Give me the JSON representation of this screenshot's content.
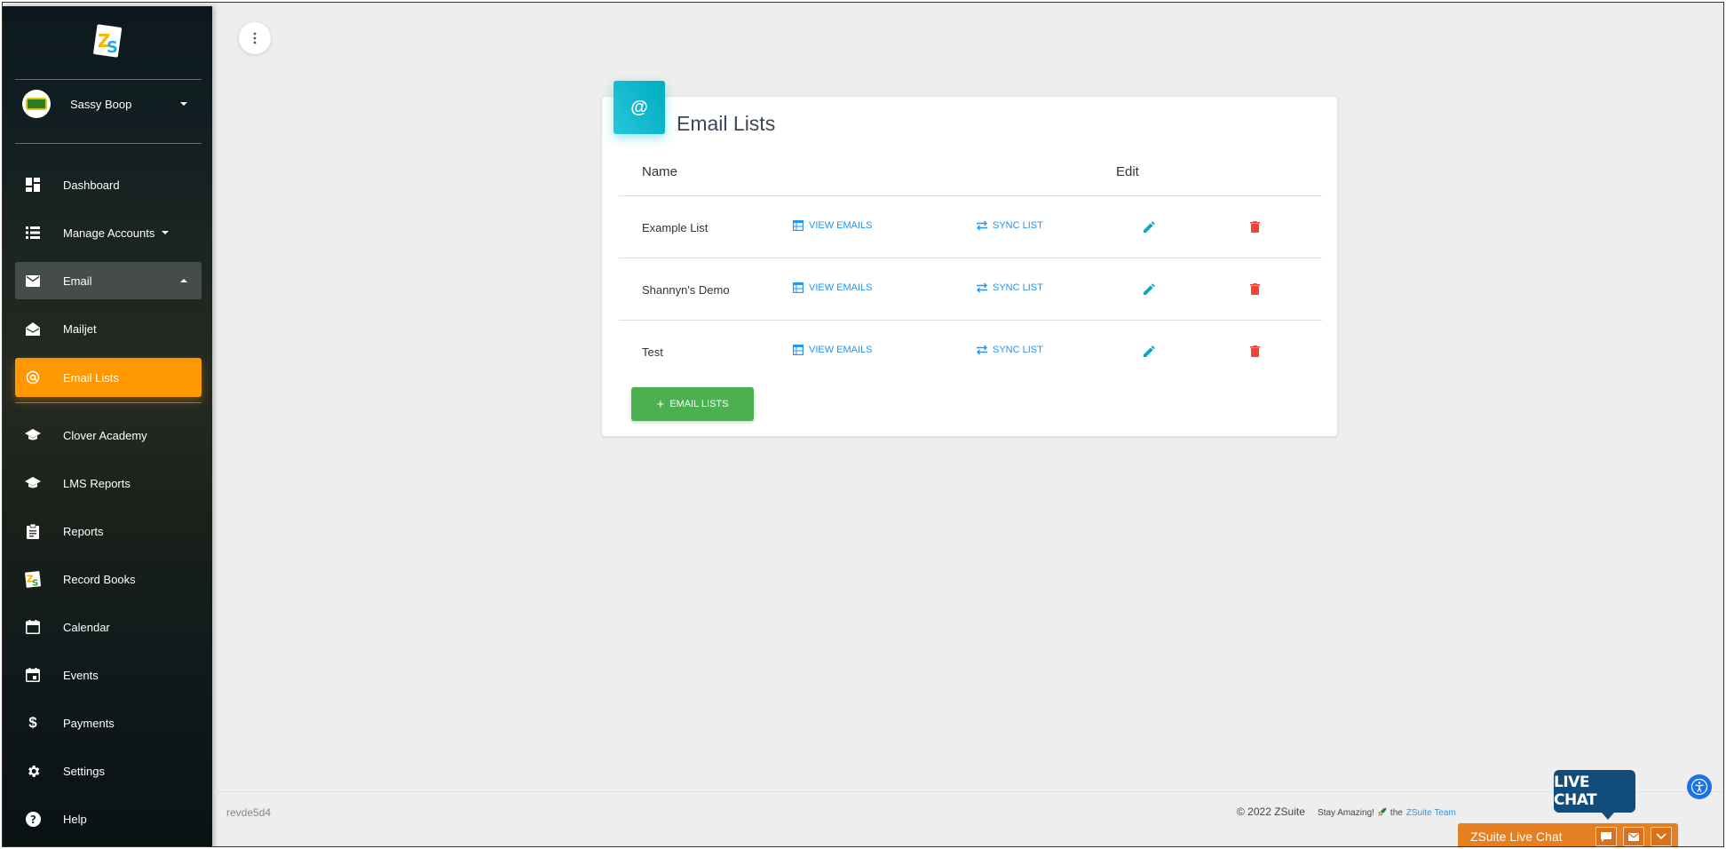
{
  "user": {
    "name": "Sassy Boop"
  },
  "sidebar": {
    "items": [
      {
        "label": "Dashboard",
        "icon": "dashboard-icon"
      },
      {
        "label": "Manage Accounts",
        "icon": "list-icon"
      },
      {
        "label": "Email",
        "icon": "mail-icon"
      },
      {
        "label": "Mailjet",
        "icon": "open-mail-icon"
      },
      {
        "label": "Email Lists",
        "icon": "at-icon"
      },
      {
        "label": "Clover Academy",
        "icon": "school-icon"
      },
      {
        "label": "LMS Reports",
        "icon": "school-icon"
      },
      {
        "label": "Reports",
        "icon": "clipboard-icon"
      },
      {
        "label": "Record Books",
        "icon": "zs-logo-icon"
      },
      {
        "label": "Calendar",
        "icon": "calendar-icon"
      },
      {
        "label": "Events",
        "icon": "event-icon"
      },
      {
        "label": "Payments",
        "icon": "dollar-icon"
      },
      {
        "label": "Settings",
        "icon": "gear-icon"
      },
      {
        "label": "Help",
        "icon": "help-icon"
      }
    ]
  },
  "card": {
    "title": "Email Lists",
    "icon_glyph": "@",
    "headers": {
      "name": "Name",
      "edit": "Edit"
    },
    "view_label": "VIEW EMAILS",
    "sync_label": "SYNC LIST",
    "rows": [
      {
        "name": "Example List"
      },
      {
        "name": "Shannyn's Demo"
      },
      {
        "name": "Test"
      }
    ],
    "add_button": "EMAIL LISTS",
    "add_button_plus": "+"
  },
  "footer": {
    "version": "revde5d4",
    "copyright": "© 2022 ZSuite",
    "stay": "Stay Amazing!",
    "the": "the",
    "team": "ZSuite Team"
  },
  "live_chat": {
    "bubble": "LIVE CHAT",
    "bar_label": "ZSuite Live Chat"
  },
  "colors": {
    "accent_orange": "#ff9800",
    "cyan": "#00acc1",
    "link_blue": "#2196f3",
    "edit_teal": "#00acc1",
    "delete_red": "#f44336",
    "green": "#4caf50"
  }
}
